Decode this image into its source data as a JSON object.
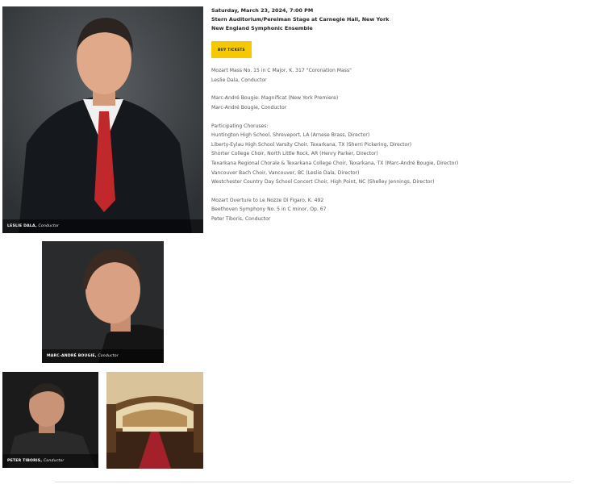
{
  "event": {
    "date_time": "Saturday, March 23, 2024, 7:00 PM",
    "venue": "Stern Auditorium/Perelman Stage at Carnegie Hall, New York",
    "ensemble": "New England Symphonic Ensemble",
    "tickets_button": "BUY TICKETS"
  },
  "program": {
    "work1": {
      "title": "Mozart Mass No. 15 in C Major, K. 317 \"Coronation Mass\"",
      "conductor": "Leslie Dala, Conductor"
    },
    "work2": {
      "title": "Marc-André Bougie: Magnificat (New York Premiere)",
      "conductor": "Marc-André Bougie, Conductor"
    },
    "choruses": {
      "heading": "Participating Choruses:",
      "items": [
        "Huntington High School, Shreveport, LA (Arnese Brass, Director)",
        "Liberty-Eylau High School Varsity Choir, Texarkana, TX (Sherri Pickering, Director)",
        "Shorter College Choir, North Little Rock, AR (Henry Parker, Director)",
        "Texarkana Regional Chorale & Texarkana College Choir, Texarkana, TX (Marc-André Bougie, Director)",
        "Vancouver Bach Choir, Vancouver, BC (Leslie Dala, Director)",
        "Westchester Country Day School Concert Choir, High Point, NC (Shelley Jennings, Director)"
      ]
    },
    "work3": {
      "line1": "Mozart Overture to Le Nozze Di Figaro, K. 492",
      "line2": "Beethoven Symphony No. 5 in C minor, Op. 67",
      "conductor": "Peter Tiboris, Conductor"
    }
  },
  "photos": {
    "p1": {
      "name": "LESLIE DALA,",
      "role": "Conductor"
    },
    "p2": {
      "name": "MARC-ANDRÉ BOUGIE,",
      "role": "Conductor"
    },
    "p3": {
      "name": "PETER TIBORIS,",
      "role": "Conductor"
    }
  }
}
